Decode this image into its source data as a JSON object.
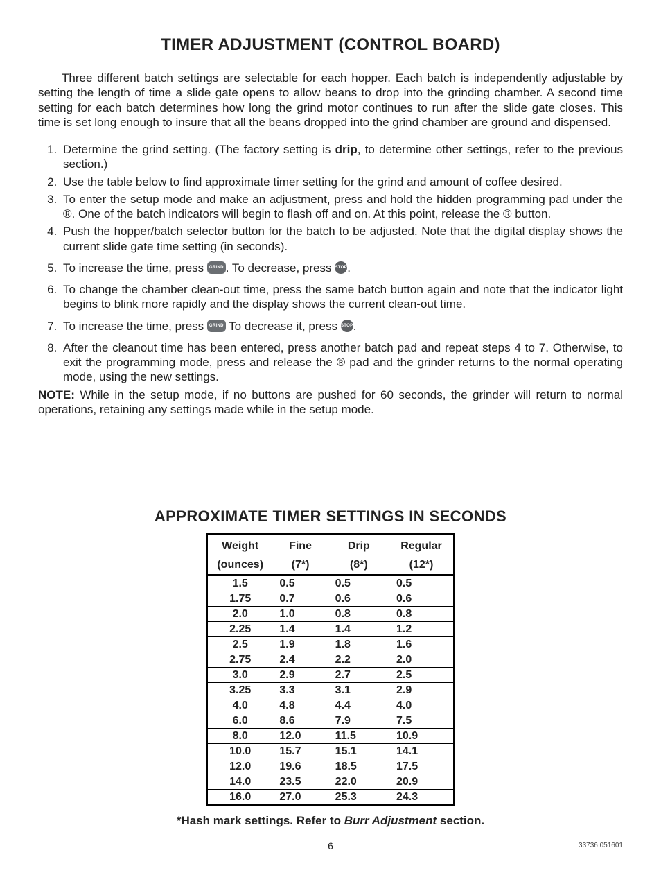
{
  "title": "TIMER ADJUSTMENT (CONTROL BOARD)",
  "intro": "Three different batch settings are selectable for each hopper. Each batch is independently adjustable by setting the length of time a slide gate opens to allow beans to drop into the grinding chamber. A second time setting for each batch determines how long the grind motor continues to run after the slide gate closes. This time is set long enough to insure that all the beans dropped into the grind chamber are ground and dispensed.",
  "steps": {
    "s1a": "Determine the grind setting. (The factory setting is ",
    "s1b": "drip",
    "s1c": ", to determine other settings, refer to the previous section.)",
    "s2": "Use the table below to find approximate timer setting for the grind and amount of coffee desired.",
    "s3": "To enter the setup mode and make an adjustment, press and hold the hidden programming pad under the ®. One of the batch indicators will begin to flash off and on.  At this point, release the ® button.",
    "s4": "Push the hopper/batch selector button for the batch to be adjusted. Note that the digital display shows the current slide gate time setting (in seconds).",
    "s5a": "To increase the time, press ",
    "s5b": ".  To decrease, press ",
    "s5c": ".",
    "s6": "To change the chamber clean-out time, press the same batch button again and note that the indicator light begins to blink more rapidly and the display shows the current clean-out time.",
    "s7a": "To increase the time, press ",
    "s7b": " To decrease it, press ",
    "s7c": ".",
    "s8": "After the cleanout time has been entered, press another batch pad and repeat steps 4 to 7. Otherwise, to exit the programming mode, press and release the ® pad and the grinder returns to the normal operating mode, using the new settings."
  },
  "buttons": {
    "grind": "GRIND",
    "stop": "STOP"
  },
  "note_label": "NOTE:",
  "note_text": " While in the setup mode, if no buttons are pushed for 60 seconds, the grinder will return to normal operations, retaining any settings made while in the setup mode.",
  "table_title": "APPROXIMATE TIMER SETTINGS IN SECONDS",
  "chart_data": {
    "type": "table",
    "columns": [
      {
        "h1": "Weight",
        "h2": "(ounces)"
      },
      {
        "h1": "Fine",
        "h2": "(7*)"
      },
      {
        "h1": "Drip",
        "h2": "(8*)"
      },
      {
        "h1": "Regular",
        "h2": "(12*)"
      }
    ],
    "rows": [
      [
        "1.5",
        "0.5",
        "0.5",
        "0.5"
      ],
      [
        "1.75",
        "0.7",
        "0.6",
        "0.6"
      ],
      [
        "2.0",
        "1.0",
        "0.8",
        "0.8"
      ],
      [
        "2.25",
        "1.4",
        "1.4",
        "1.2"
      ],
      [
        "2.5",
        "1.9",
        "1.8",
        "1.6"
      ],
      [
        "2.75",
        "2.4",
        "2.2",
        "2.0"
      ],
      [
        "3.0",
        "2.9",
        "2.7",
        "2.5"
      ],
      [
        "3.25",
        "3.3",
        "3.1",
        "2.9"
      ],
      [
        "4.0",
        "4.8",
        "4.4",
        "4.0"
      ],
      [
        "6.0",
        "8.6",
        "7.9",
        "7.5"
      ],
      [
        "8.0",
        "12.0",
        "11.5",
        "10.9"
      ],
      [
        "10.0",
        "15.7",
        "15.1",
        "14.1"
      ],
      [
        "12.0",
        "19.6",
        "18.5",
        "17.5"
      ],
      [
        "14.0",
        "23.5",
        "22.0",
        "20.9"
      ],
      [
        "16.0",
        "27.0",
        "25.3",
        "24.3"
      ]
    ]
  },
  "hash_note_a": "*Hash mark settings.  Refer to ",
  "hash_note_b": "Burr Adjustment",
  "hash_note_c": " section.",
  "page_number": "6",
  "doc_code": "33736  051601"
}
